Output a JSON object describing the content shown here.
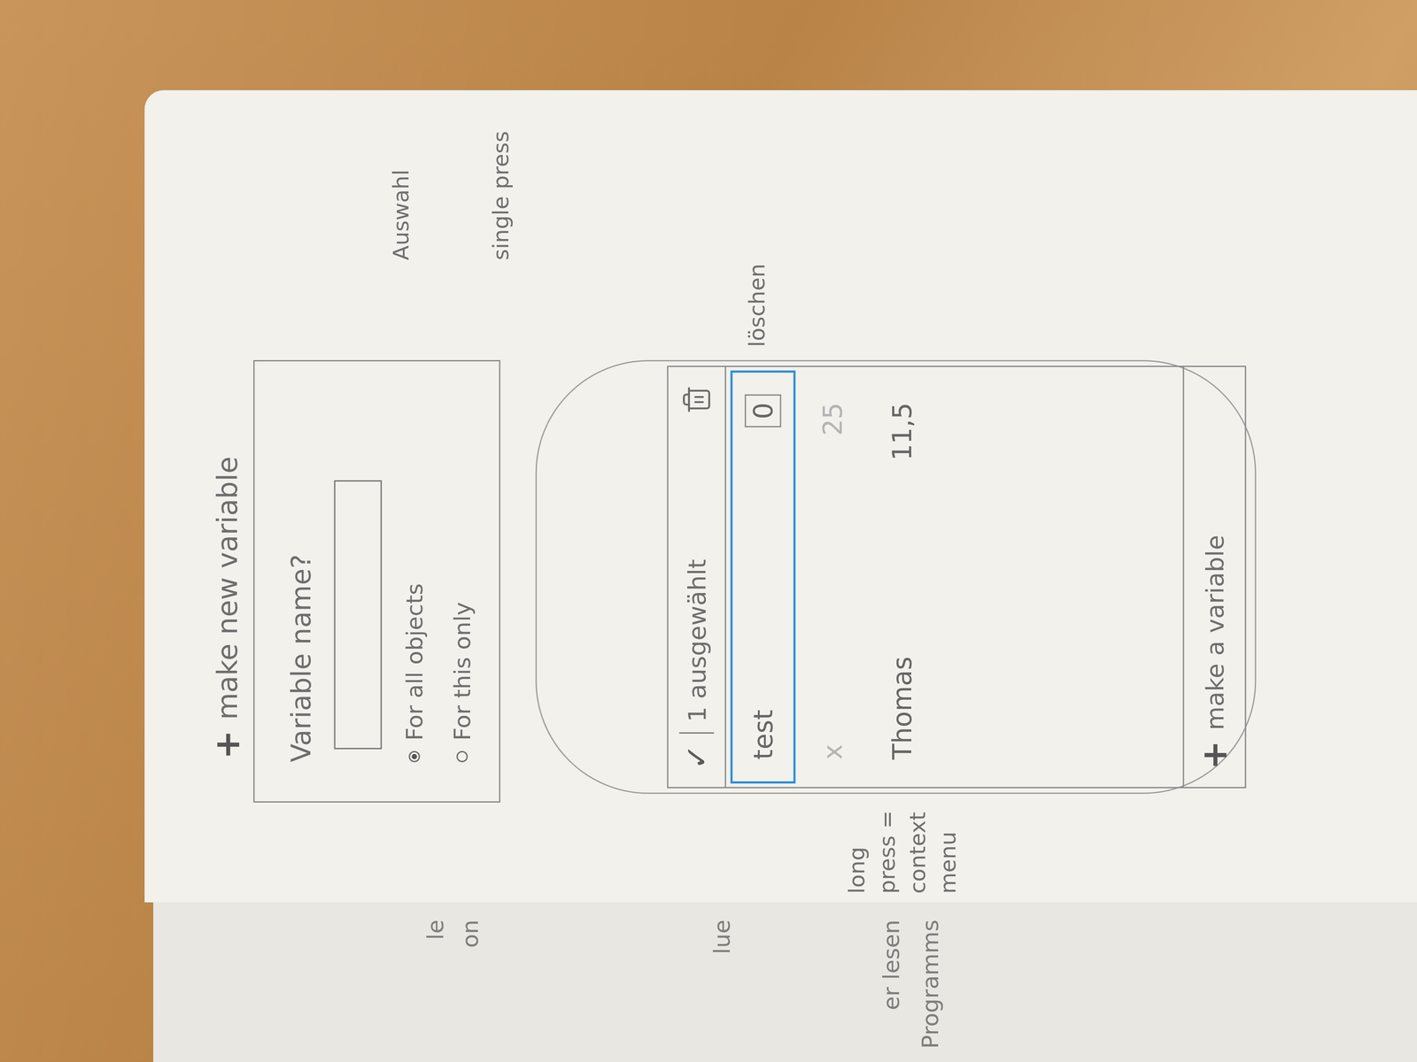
{
  "heading": {
    "icon": "+",
    "label": "make new variable"
  },
  "dialog": {
    "title": "Variable name?",
    "input": {
      "value": ""
    },
    "options": [
      {
        "label": "For all objects",
        "selected": true
      },
      {
        "label": "For this only",
        "selected": false
      }
    ]
  },
  "phone": {
    "action_bar": {
      "check": "✓",
      "count": "1 ausgewählt"
    },
    "rows": [
      {
        "name": "test",
        "value": "0",
        "selected": true,
        "faded": false
      },
      {
        "name": "x",
        "value": "25",
        "selected": false,
        "faded": true
      },
      {
        "name": "Thomas",
        "value": "11,5",
        "selected": false,
        "faded": false
      }
    ],
    "add_button": {
      "icon": "+",
      "label": "make a variable"
    }
  },
  "annotations": {
    "single_press": {
      "lines": [
        "Auswahl",
        "single press"
      ]
    },
    "delete": {
      "lines": [
        "löschen"
      ]
    },
    "long_press": {
      "lines": [
        "long",
        "press =",
        "context",
        "menu"
      ]
    }
  },
  "other_page": {
    "fragments": [
      "le",
      "on",
      "lue",
      "er lesen",
      "Programms"
    ]
  }
}
